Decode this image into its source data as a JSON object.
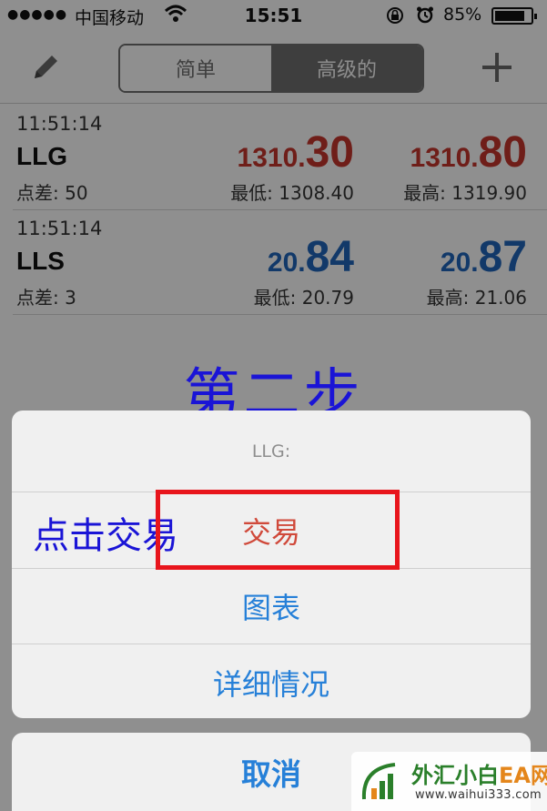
{
  "status_bar": {
    "carrier": "中国移动",
    "time": "15:51",
    "battery": "85%",
    "battery_level": 0.85
  },
  "nav": {
    "segments": [
      "简单",
      "高级的"
    ],
    "selected": "高级的"
  },
  "quotes": [
    {
      "time": "11:51:14",
      "symbol": "LLG",
      "spread": "点差: 50",
      "bid_prefix": "1310.",
      "bid_big": "30",
      "ask_prefix": "1310.",
      "ask_big": "80",
      "low": "最低: 1308.40",
      "high": "最高: 1319.90",
      "color": "#c0342b"
    },
    {
      "time": "11:51:14",
      "symbol": "LLS",
      "spread": "点差: 3",
      "bid_prefix": "20.",
      "bid_big": "84",
      "ask_prefix": "20.",
      "ask_big": "87",
      "low": "最低: 20.79",
      "high": "最高: 21.06",
      "color": "#1f62b5"
    }
  ],
  "annotation": {
    "step": "第二步",
    "click_note": "点击交易"
  },
  "action_sheet": {
    "title": "LLG:",
    "options": [
      "交易",
      "图表",
      "详细情况"
    ],
    "cancel": "取消"
  },
  "watermark": {
    "name_cn": "外汇小白",
    "name_ea": "EA网",
    "url": "www.waihui333.com"
  }
}
